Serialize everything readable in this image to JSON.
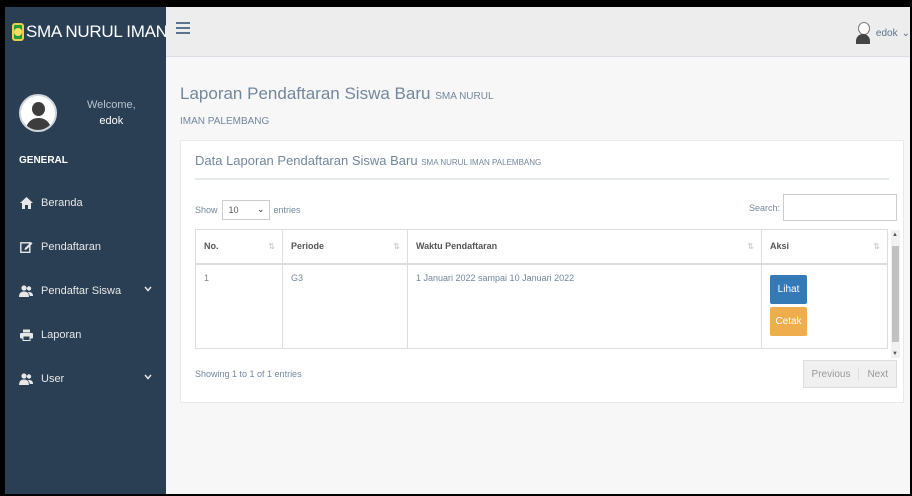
{
  "brand": {
    "name": "SMA NURUL IMAN"
  },
  "profile": {
    "welcome": "Welcome,",
    "username": "edok"
  },
  "sidebar": {
    "section_title": "GENERAL",
    "items": [
      {
        "label": "Beranda",
        "icon": "home-icon"
      },
      {
        "label": "Pendaftaran",
        "icon": "edit-icon"
      },
      {
        "label": "Pendaftar Siswa",
        "icon": "users-icon",
        "expandable": true
      },
      {
        "label": "Laporan",
        "icon": "print-icon"
      },
      {
        "label": "User",
        "icon": "users-icon",
        "expandable": true
      }
    ]
  },
  "topbar": {
    "username": "edok",
    "chevron": "⌄"
  },
  "page": {
    "title": "Laporan Pendaftaran Siswa Baru",
    "title_small_1": "SMA NURUL",
    "title_small_2": "IMAN PALEMBANG"
  },
  "panel": {
    "title": "Data Laporan Pendaftaran Siswa Baru",
    "title_small": "SMA NURUL IMAN PALEMBANG"
  },
  "table_controls": {
    "show_label": "Show",
    "page_length": "10",
    "entries_label": "entries",
    "search_label": "Search:",
    "search_value": ""
  },
  "table": {
    "columns": [
      "No.",
      "Periode",
      "Waktu Pendaftaran",
      "Aksi"
    ],
    "rows": [
      {
        "no": "1",
        "periode": "G3",
        "waktu": "1 Januari 2022 sampai 10 Januari 2022",
        "lihat": "Lihat",
        "cetak": "Cetak"
      }
    ]
  },
  "footer": {
    "info": "Showing 1 to 1 of 1 entries",
    "previous": "Previous",
    "next": "Next"
  },
  "colors": {
    "sidebar_bg": "#2a3f54",
    "btn_primary": "#337ab7",
    "btn_warning": "#f0ad4e",
    "text_muted": "#73879c"
  }
}
